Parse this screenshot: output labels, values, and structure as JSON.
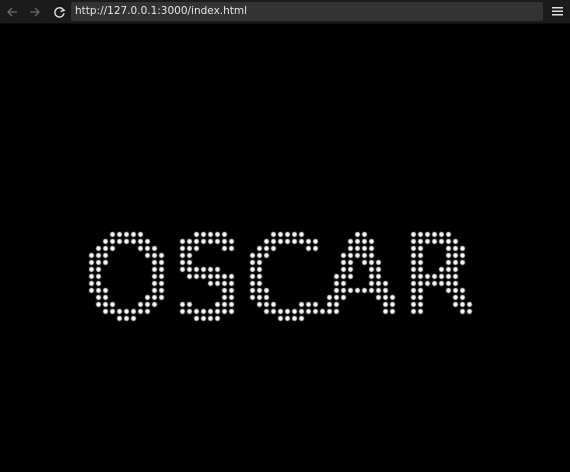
{
  "browser": {
    "url": "http://127.0.0.1:3000/index.html",
    "back_icon": "arrow-left-icon",
    "forward_icon": "arrow-right-icon",
    "reload_icon": "reload-icon",
    "menu_icon": "hamburger-menu-icon",
    "toolbar_color": "#1b1b1b",
    "urlbar_color": "#333333"
  },
  "page": {
    "background": "#000000",
    "dot_text": "OSCAR",
    "dot_color": "#ffffff"
  }
}
